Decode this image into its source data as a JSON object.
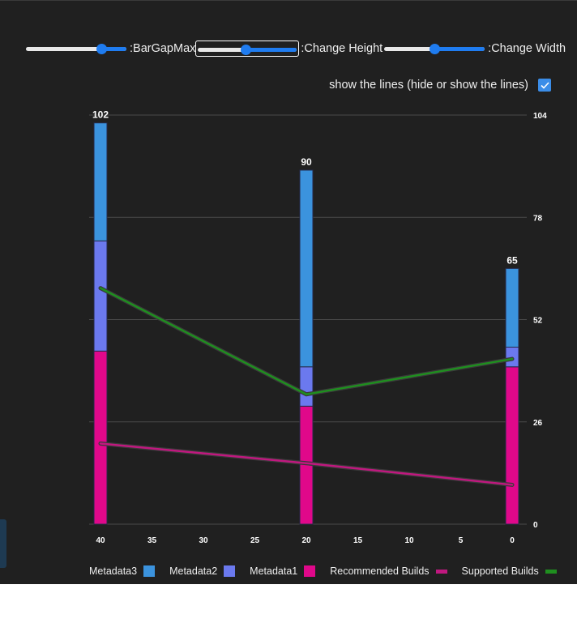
{
  "controls": {
    "bar_gap_label": ":BarGapMax",
    "bar_gap_fraction": 0.78,
    "height_label": ":Change Height",
    "height_fraction": 0.48,
    "width_label": ":Change Width",
    "width_fraction": 0.5
  },
  "lines_toggle": {
    "label": "show the lines (hide or show the lines)",
    "checked": true
  },
  "colors": {
    "background": "#202020",
    "metadata1": "#e0088a",
    "metadata2": "#6b79ee",
    "metadata3": "#3b93de",
    "recommended_builds": "#c0187f",
    "supported_builds": "#1f8f1f",
    "axis_text": "#ffffff",
    "grid": "#4a4a4a"
  },
  "chart_data": {
    "type": "bar",
    "stacked": true,
    "x": [
      40,
      20,
      0
    ],
    "xlim": [
      40,
      0
    ],
    "x_ticks": [
      40,
      35,
      30,
      25,
      20,
      15,
      10,
      5,
      0
    ],
    "ylim": [
      0,
      104
    ],
    "y_ticks": [
      0,
      26,
      52,
      78,
      104
    ],
    "y_axis_side": "right",
    "grid": true,
    "legend_position": "bottom",
    "totals": [
      102,
      90,
      65
    ],
    "series": [
      {
        "name": "Metadata1",
        "type": "bar",
        "values": [
          44,
          30,
          40
        ]
      },
      {
        "name": "Metadata2",
        "type": "bar",
        "values": [
          28,
          10,
          5
        ]
      },
      {
        "name": "Metadata3",
        "type": "bar",
        "values": [
          30,
          50,
          20
        ]
      },
      {
        "name": "Recommended Builds",
        "type": "line",
        "values": [
          20.5,
          15.5,
          10
        ]
      },
      {
        "name": "Supported Builds",
        "type": "line",
        "values": [
          60,
          33,
          42
        ]
      }
    ],
    "legend_order": [
      "Metadata3",
      "Metadata2",
      "Metadata1",
      "Recommended Builds",
      "Supported Builds"
    ]
  }
}
